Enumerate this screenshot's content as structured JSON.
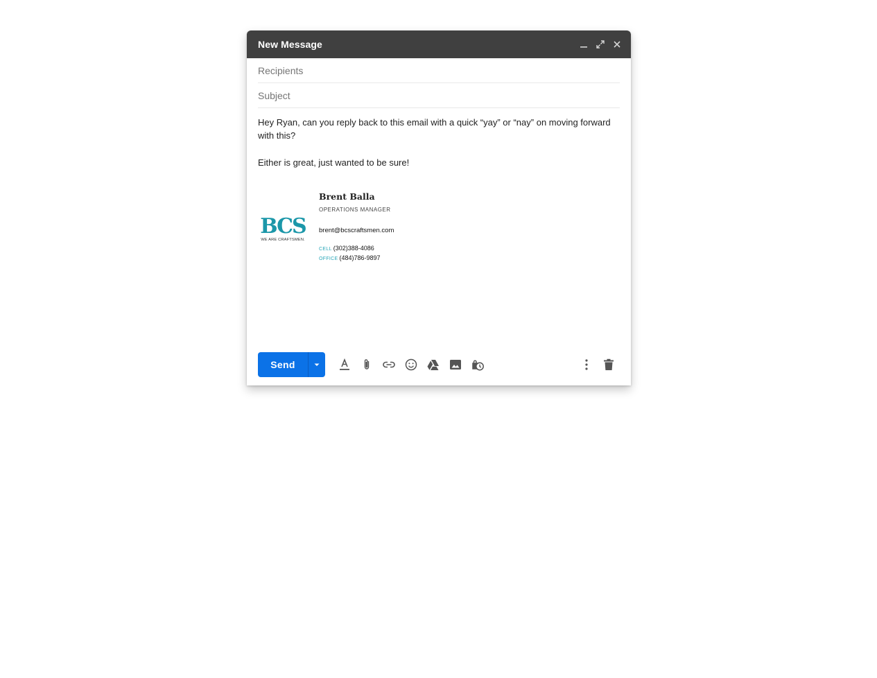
{
  "window": {
    "title": "New Message",
    "controls": [
      "minimize-icon",
      "expand-icon",
      "close-icon"
    ]
  },
  "recipients": {
    "placeholder": "Recipients",
    "value": ""
  },
  "subject": {
    "placeholder": "Subject",
    "value": ""
  },
  "body": {
    "paragraphs": [
      "Hey Ryan, can you reply back to this email with a quick “yay” or “nay” on moving forward with this?",
      "Either is great, just wanted to be sure!"
    ]
  },
  "signature": {
    "logo_text": "BCS",
    "logo_tagline": "WE ARE CRAFTSMEN.",
    "name": "Brent Balla",
    "title": "OPERATIONS MANAGER",
    "email": "brent@bcscraftsmen.com",
    "cell_label": "CELL",
    "cell": "(302)388-4086",
    "office_label": "OFFICE",
    "office": "(484)786-9897",
    "accent_color": "#2aa7b8"
  },
  "toolbar": {
    "send_label": "Send",
    "send_color": "#0b72e7",
    "tools": [
      "format-text-icon",
      "attach-icon",
      "link-icon",
      "emoji-icon",
      "drive-icon",
      "image-icon",
      "confidential-icon"
    ],
    "right_tools": [
      "more-options-icon",
      "trash-icon"
    ]
  }
}
